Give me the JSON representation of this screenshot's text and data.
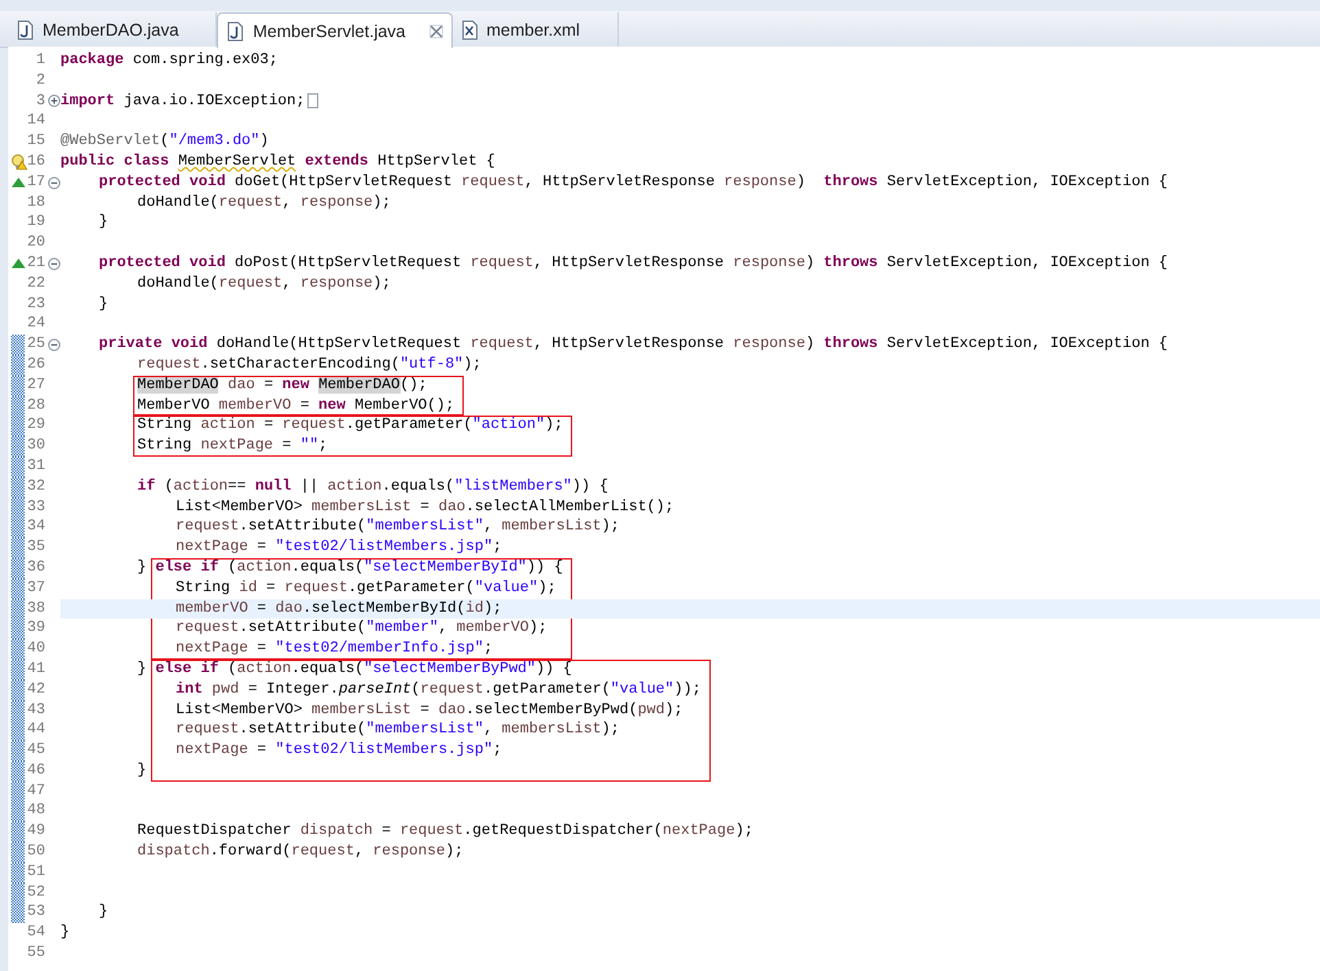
{
  "tabs": [
    {
      "label": "MemberDAO.java",
      "kind": "java",
      "selected": false
    },
    {
      "label": "MemberServlet.java",
      "kind": "java",
      "selected": true
    },
    {
      "label": "member.xml",
      "kind": "xml",
      "selected": false
    }
  ],
  "lines": [
    {
      "number": "1",
      "changed": false,
      "current": false,
      "tokens": [
        {
          "kind": "keyword",
          "text": "package"
        },
        {
          "kind": "plain",
          "text": " com.spring.ex03;"
        }
      ]
    },
    {
      "number": "2",
      "changed": false,
      "current": false
    },
    {
      "number": "3",
      "changed": false,
      "current": false,
      "fold_collapsed": true,
      "tokens": [
        {
          "kind": "keyword",
          "text": "import"
        },
        {
          "kind": "plain",
          "text": " java.io.IOException;"
        }
      ]
    },
    {
      "number": "14",
      "changed": false,
      "current": false
    },
    {
      "number": "15",
      "changed": false,
      "current": false,
      "tokens": [
        {
          "kind": "annotation",
          "text": "@WebServlet"
        },
        {
          "kind": "plain",
          "text": "("
        },
        {
          "kind": "string",
          "text": "\"/mem3.do\""
        },
        {
          "kind": "plain",
          "text": ")"
        }
      ]
    },
    {
      "number": "16",
      "changed": false,
      "current": false,
      "warning": true,
      "tokens": [
        {
          "kind": "keyword",
          "text": "public"
        },
        {
          "kind": "keyword",
          "text": " class "
        },
        {
          "kind": "plain",
          "text": "MemberServlet",
          "warning": true
        },
        {
          "kind": "keyword",
          "text": " extends"
        },
        {
          "kind": "plain",
          "text": " HttpServlet {"
        }
      ]
    },
    {
      "number": "17",
      "changed": false,
      "current": false,
      "override": true,
      "fold_expanded": true,
      "tokens": [
        {
          "kind": "keyword",
          "text": "\tprotected"
        },
        {
          "kind": "keyword",
          "text": " void"
        },
        {
          "kind": "plain",
          "text": " doGet(HttpServletRequest "
        },
        {
          "kind": "variable",
          "text": "request"
        },
        {
          "kind": "plain",
          "text": ", HttpServletResponse "
        },
        {
          "kind": "variable",
          "text": "response"
        },
        {
          "kind": "plain",
          "text": ")  "
        },
        {
          "kind": "keyword",
          "text": "throws"
        },
        {
          "kind": "plain",
          "text": " ServletException, IOException {"
        }
      ]
    },
    {
      "number": "18",
      "changed": false,
      "current": false,
      "tokens": [
        {
          "kind": "plain",
          "text": "\t\tdoHandle("
        },
        {
          "kind": "variable",
          "text": "request"
        },
        {
          "kind": "plain",
          "text": ", "
        },
        {
          "kind": "variable",
          "text": "response"
        },
        {
          "kind": "plain",
          "text": ");"
        }
      ]
    },
    {
      "number": "19",
      "changed": false,
      "current": false,
      "tokens": [
        {
          "kind": "plain",
          "text": "\t}"
        }
      ]
    },
    {
      "number": "20",
      "changed": false,
      "current": false
    },
    {
      "number": "21",
      "changed": false,
      "current": false,
      "override": true,
      "fold_expanded": true,
      "tokens": [
        {
          "kind": "keyword",
          "text": "\tprotected"
        },
        {
          "kind": "keyword",
          "text": " void"
        },
        {
          "kind": "plain",
          "text": " doPost(HttpServletRequest "
        },
        {
          "kind": "variable",
          "text": "request"
        },
        {
          "kind": "plain",
          "text": ", HttpServletResponse "
        },
        {
          "kind": "variable",
          "text": "response"
        },
        {
          "kind": "plain",
          "text": ") "
        },
        {
          "kind": "keyword",
          "text": "throws"
        },
        {
          "kind": "plain",
          "text": " ServletException, IOException {"
        }
      ]
    },
    {
      "number": "22",
      "changed": false,
      "current": false,
      "tokens": [
        {
          "kind": "plain",
          "text": "\t\tdoHandle("
        },
        {
          "kind": "variable",
          "text": "request"
        },
        {
          "kind": "plain",
          "text": ", "
        },
        {
          "kind": "variable",
          "text": "response"
        },
        {
          "kind": "plain",
          "text": ");"
        }
      ]
    },
    {
      "number": "23",
      "changed": false,
      "current": false,
      "tokens": [
        {
          "kind": "plain",
          "text": "\t}"
        }
      ]
    },
    {
      "number": "24",
      "changed": false,
      "current": false
    },
    {
      "number": "25",
      "changed": true,
      "current": false,
      "fold_expanded": true,
      "tokens": [
        {
          "kind": "keyword",
          "text": "\tprivate"
        },
        {
          "kind": "keyword",
          "text": " void"
        },
        {
          "kind": "plain",
          "text": " doHandle(HttpServletRequest "
        },
        {
          "kind": "variable",
          "text": "request"
        },
        {
          "kind": "plain",
          "text": ", HttpServletResponse "
        },
        {
          "kind": "variable",
          "text": "response"
        },
        {
          "kind": "plain",
          "text": ") "
        },
        {
          "kind": "keyword",
          "text": "throws"
        },
        {
          "kind": "plain",
          "text": " ServletException, IOException {"
        }
      ]
    },
    {
      "number": "26",
      "changed": true,
      "current": false,
      "tokens": [
        {
          "kind": "variable",
          "text": "\t\trequest"
        },
        {
          "kind": "plain",
          "text": ".setCharacterEncoding("
        },
        {
          "kind": "string",
          "text": "\"utf-8\""
        },
        {
          "kind": "plain",
          "text": ");"
        }
      ]
    },
    {
      "number": "27",
      "changed": true,
      "current": false,
      "boxed": true,
      "tokens": [
        {
          "kind": "plain",
          "text": "\t\tMemberDAO",
          "occurrence": true,
          "box_start": true
        },
        {
          "kind": "variable",
          "text": " dao"
        },
        {
          "kind": "plain",
          "text": " = "
        },
        {
          "kind": "keyword",
          "text": "new"
        },
        {
          "kind": "plain",
          "text": " MemberDAO",
          "occurrence": true
        },
        {
          "kind": "plain",
          "text": "();"
        }
      ]
    },
    {
      "number": "28",
      "changed": true,
      "current": false,
      "boxed": true,
      "tokens": [
        {
          "kind": "plain",
          "text": "\t\tMemberVO "
        },
        {
          "kind": "variable",
          "text": "memberVO"
        },
        {
          "kind": "plain",
          "text": " = "
        },
        {
          "kind": "keyword",
          "text": "new"
        },
        {
          "kind": "plain",
          "text": " MemberVO();"
        }
      ]
    },
    {
      "number": "29",
      "changed": true,
      "current": false,
      "boxed": true,
      "tokens": [
        {
          "kind": "plain",
          "text": "\t\tString",
          "box_start": true
        },
        {
          "kind": "variable",
          "text": " action"
        },
        {
          "kind": "plain",
          "text": " = "
        },
        {
          "kind": "variable",
          "text": "request"
        },
        {
          "kind": "plain",
          "text": ".getParameter("
        },
        {
          "kind": "string",
          "text": "\"action\""
        },
        {
          "kind": "plain",
          "text": ");"
        }
      ]
    },
    {
      "number": "30",
      "changed": true,
      "current": false,
      "boxed": true,
      "tokens": [
        {
          "kind": "plain",
          "text": "\t\tString "
        },
        {
          "kind": "variable",
          "text": "nextPage"
        },
        {
          "kind": "plain",
          "text": " = "
        },
        {
          "kind": "string",
          "text": "\"\""
        },
        {
          "kind": "plain",
          "text": ";"
        }
      ]
    },
    {
      "number": "31",
      "changed": true,
      "current": false
    },
    {
      "number": "32",
      "changed": true,
      "current": false,
      "tokens": [
        {
          "kind": "keyword",
          "text": "\t\tif"
        },
        {
          "kind": "plain",
          "text": " ("
        },
        {
          "kind": "variable",
          "text": "action"
        },
        {
          "kind": "plain",
          "text": "== "
        },
        {
          "kind": "keyword",
          "text": "null"
        },
        {
          "kind": "plain",
          "text": " || "
        },
        {
          "kind": "variable",
          "text": "action"
        },
        {
          "kind": "plain",
          "text": ".equals("
        },
        {
          "kind": "string",
          "text": "\"listMembers\""
        },
        {
          "kind": "plain",
          "text": ")) {"
        }
      ]
    },
    {
      "number": "33",
      "changed": true,
      "current": false,
      "tokens": [
        {
          "kind": "plain",
          "text": "\t\t\tList<MemberVO> "
        },
        {
          "kind": "variable",
          "text": "membersList"
        },
        {
          "kind": "plain",
          "text": " = "
        },
        {
          "kind": "variable",
          "text": "dao"
        },
        {
          "kind": "plain",
          "text": ".selectAllMemberList();"
        }
      ]
    },
    {
      "number": "34",
      "changed": true,
      "current": false,
      "tokens": [
        {
          "kind": "variable",
          "text": "\t\t\trequest"
        },
        {
          "kind": "plain",
          "text": ".setAttribute("
        },
        {
          "kind": "string",
          "text": "\"membersList\""
        },
        {
          "kind": "plain",
          "text": ", "
        },
        {
          "kind": "variable",
          "text": "membersList"
        },
        {
          "kind": "plain",
          "text": ");"
        }
      ]
    },
    {
      "number": "35",
      "changed": true,
      "current": false,
      "tokens": [
        {
          "kind": "variable",
          "text": "\t\t\tnextPage"
        },
        {
          "kind": "plain",
          "text": " = "
        },
        {
          "kind": "string",
          "text": "\"test02/listMembers.jsp\""
        },
        {
          "kind": "plain",
          "text": ";"
        }
      ]
    },
    {
      "number": "36",
      "changed": true,
      "current": false,
      "boxed": true,
      "tokens": [
        {
          "kind": "plain",
          "text": "\t\t}"
        },
        {
          "kind": "keyword",
          "text": " else",
          "box_start": true
        },
        {
          "kind": "keyword",
          "text": " if"
        },
        {
          "kind": "plain",
          "text": " ("
        },
        {
          "kind": "variable",
          "text": "action"
        },
        {
          "kind": "plain",
          "text": ".equals("
        },
        {
          "kind": "string",
          "text": "\"selectMemberById\""
        },
        {
          "kind": "plain",
          "text": ")) {"
        }
      ]
    },
    {
      "number": "37",
      "changed": true,
      "current": false,
      "boxed": true,
      "tokens": [
        {
          "kind": "plain",
          "text": "\t\t\tString "
        },
        {
          "kind": "variable",
          "text": "id"
        },
        {
          "kind": "plain",
          "text": " = "
        },
        {
          "kind": "variable",
          "text": "request"
        },
        {
          "kind": "plain",
          "text": ".getParameter("
        },
        {
          "kind": "string",
          "text": "\"value\""
        },
        {
          "kind": "plain",
          "text": ");"
        }
      ]
    },
    {
      "number": "38",
      "changed": true,
      "current": true,
      "boxed": true,
      "tokens": [
        {
          "kind": "variable",
          "text": "\t\t\tmemberVO"
        },
        {
          "kind": "plain",
          "text": " = "
        },
        {
          "kind": "variable",
          "text": "dao"
        },
        {
          "kind": "plain",
          "text": ".selectMemberById("
        },
        {
          "kind": "variable",
          "text": "id"
        },
        {
          "kind": "plain",
          "text": ");"
        }
      ]
    },
    {
      "number": "39",
      "changed": true,
      "current": false,
      "boxed": true,
      "tokens": [
        {
          "kind": "variable",
          "text": "\t\t\trequest"
        },
        {
          "kind": "plain",
          "text": ".setAttribute("
        },
        {
          "kind": "string",
          "text": "\"member\""
        },
        {
          "kind": "plain",
          "text": ", "
        },
        {
          "kind": "variable",
          "text": "memberVO"
        },
        {
          "kind": "plain",
          "text": ");"
        }
      ]
    },
    {
      "number": "40",
      "changed": true,
      "current": false,
      "boxed": true,
      "tokens": [
        {
          "kind": "variable",
          "text": "\t\t\tnextPage"
        },
        {
          "kind": "plain",
          "text": " = "
        },
        {
          "kind": "string",
          "text": "\"test02/memberInfo.jsp\""
        },
        {
          "kind": "plain",
          "text": ";"
        }
      ]
    },
    {
      "number": "41",
      "changed": true,
      "current": false,
      "boxed": true,
      "tokens": [
        {
          "kind": "plain",
          "text": "\t\t}"
        },
        {
          "kind": "keyword",
          "text": " else",
          "box_start": true
        },
        {
          "kind": "keyword",
          "text": " if"
        },
        {
          "kind": "plain",
          "text": " ("
        },
        {
          "kind": "variable",
          "text": "action"
        },
        {
          "kind": "plain",
          "text": ".equals("
        },
        {
          "kind": "string",
          "text": "\"selectMemberByPwd\""
        },
        {
          "kind": "plain",
          "text": ")) {"
        }
      ]
    },
    {
      "number": "42",
      "changed": true,
      "current": false,
      "boxed": true,
      "tokens": [
        {
          "kind": "keyword",
          "text": "\t\t\tint"
        },
        {
          "kind": "variable",
          "text": " pwd"
        },
        {
          "kind": "plain",
          "text": " = Integer."
        },
        {
          "kind": "static_method",
          "text": "parseInt"
        },
        {
          "kind": "plain",
          "text": "("
        },
        {
          "kind": "variable",
          "text": "request"
        },
        {
          "kind": "plain",
          "text": ".getParameter("
        },
        {
          "kind": "string",
          "text": "\"value\""
        },
        {
          "kind": "plain",
          "text": "));"
        }
      ]
    },
    {
      "number": "43",
      "changed": true,
      "current": false,
      "boxed": true,
      "tokens": [
        {
          "kind": "plain",
          "text": "\t\t\tList<MemberVO> "
        },
        {
          "kind": "variable",
          "text": "membersList"
        },
        {
          "kind": "plain",
          "text": " = "
        },
        {
          "kind": "variable",
          "text": "dao"
        },
        {
          "kind": "plain",
          "text": ".selectMemberByPwd("
        },
        {
          "kind": "variable",
          "text": "pwd"
        },
        {
          "kind": "plain",
          "text": ");"
        }
      ]
    },
    {
      "number": "44",
      "changed": true,
      "current": false,
      "boxed": true,
      "tokens": [
        {
          "kind": "variable",
          "text": "\t\t\trequest"
        },
        {
          "kind": "plain",
          "text": ".setAttribute("
        },
        {
          "kind": "string",
          "text": "\"membersList\""
        },
        {
          "kind": "plain",
          "text": ", "
        },
        {
          "kind": "variable",
          "text": "membersList"
        },
        {
          "kind": "plain",
          "text": ");"
        }
      ]
    },
    {
      "number": "45",
      "changed": true,
      "current": false,
      "boxed": true,
      "tokens": [
        {
          "kind": "variable",
          "text": "\t\t\tnextPage"
        },
        {
          "kind": "plain",
          "text": " = "
        },
        {
          "kind": "string",
          "text": "\"test02/listMembers.jsp\""
        },
        {
          "kind": "plain",
          "text": ";"
        }
      ]
    },
    {
      "number": "46",
      "changed": true,
      "current": false,
      "boxed": true,
      "tokens": [
        {
          "kind": "plain",
          "text": "\t\t}"
        }
      ]
    },
    {
      "number": "47",
      "changed": true,
      "current": false
    },
    {
      "number": "48",
      "changed": true,
      "current": false
    },
    {
      "number": "49",
      "changed": true,
      "current": false,
      "tokens": [
        {
          "kind": "plain",
          "text": "\t\tRequestDispatcher "
        },
        {
          "kind": "variable",
          "text": "dispatch"
        },
        {
          "kind": "plain",
          "text": " = "
        },
        {
          "kind": "variable",
          "text": "request"
        },
        {
          "kind": "plain",
          "text": ".getRequestDispatcher("
        },
        {
          "kind": "variable",
          "text": "nextPage"
        },
        {
          "kind": "plain",
          "text": ");"
        }
      ]
    },
    {
      "number": "50",
      "changed": true,
      "current": false,
      "tokens": [
        {
          "kind": "variable",
          "text": "\t\tdispatch"
        },
        {
          "kind": "plain",
          "text": ".forward("
        },
        {
          "kind": "variable",
          "text": "request"
        },
        {
          "kind": "plain",
          "text": ", "
        },
        {
          "kind": "variable",
          "text": "response"
        },
        {
          "kind": "plain",
          "text": ");"
        }
      ]
    },
    {
      "number": "51",
      "changed": true,
      "current": false
    },
    {
      "number": "52",
      "changed": true,
      "current": false
    },
    {
      "number": "53",
      "changed": true,
      "current": false,
      "tokens": [
        {
          "kind": "plain",
          "text": "\t}"
        }
      ]
    },
    {
      "number": "54",
      "changed": false,
      "current": false,
      "tokens": [
        {
          "kind": "plain",
          "text": "}"
        }
      ]
    },
    {
      "number": "55",
      "changed": false,
      "current": false
    }
  ]
}
